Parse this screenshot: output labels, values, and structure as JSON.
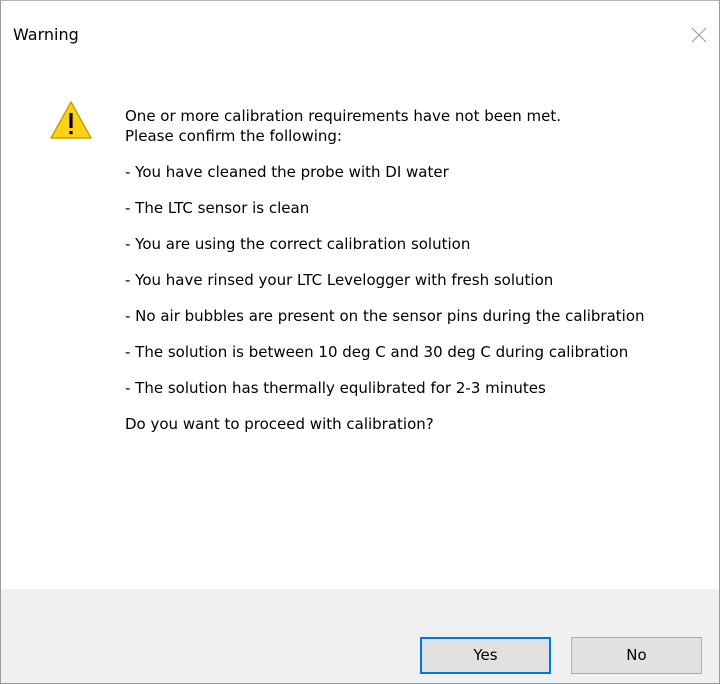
{
  "window": {
    "title": "Warning"
  },
  "message": {
    "intro_line1": "One or more calibration requirements have not been met.",
    "intro_line2": "Please confirm the following:",
    "items": [
      "- You have cleaned the probe with DI water",
      "- The LTC sensor is clean",
      "- You are using the correct calibration solution",
      "- You have rinsed your LTC Levelogger with fresh solution",
      "- No air bubbles are present on the sensor pins during the calibration",
      "- The solution is between 10 deg C and 30 deg C during calibration",
      "- The solution has thermally equlibrated for 2-3 minutes"
    ],
    "question": "Do you want to proceed with calibration?"
  },
  "buttons": {
    "yes_label": "Yes",
    "no_label": "No"
  },
  "icons": {
    "warning": "warning-triangle-icon",
    "close": "close-x-icon"
  },
  "colors": {
    "warning_fill": "#fcd116",
    "warning_stroke": "#c7a200",
    "focus_border": "#0078d7",
    "footer_bg": "#f0f0f0"
  }
}
